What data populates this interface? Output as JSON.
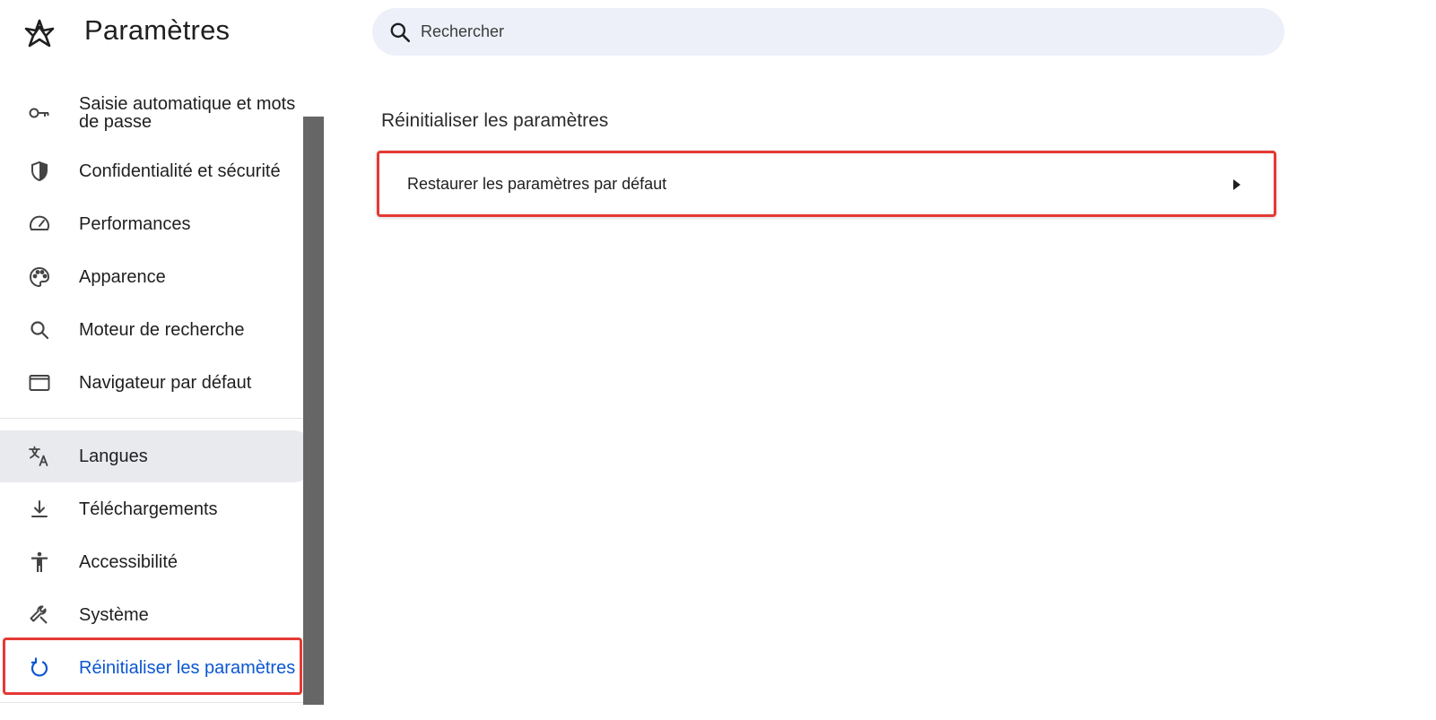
{
  "app": {
    "title": "Paramètres"
  },
  "search": {
    "placeholder": "Rechercher"
  },
  "sidebar": {
    "items": [
      {
        "label": "Saisie automatique et mots de passe",
        "icon": "key-icon"
      },
      {
        "label": "Confidentialité et sécurité",
        "icon": "shield-icon"
      },
      {
        "label": "Performances",
        "icon": "speedometer-icon"
      },
      {
        "label": "Apparence",
        "icon": "palette-icon"
      },
      {
        "label": "Moteur de recherche",
        "icon": "search-icon"
      },
      {
        "label": "Navigateur par défaut",
        "icon": "browser-window-icon"
      },
      {
        "label": "Langues",
        "icon": "translate-icon",
        "state": "hovered"
      },
      {
        "label": "Téléchargements",
        "icon": "download-icon"
      },
      {
        "label": "Accessibilité",
        "icon": "accessibility-icon"
      },
      {
        "label": "Système",
        "icon": "wrench-icon"
      },
      {
        "label": "Réinitialiser les paramètres",
        "icon": "reset-icon",
        "state": "selected"
      }
    ]
  },
  "main": {
    "section_title": "Réinitialiser les paramètres",
    "card": {
      "label": "Restaurer les paramètres par défaut",
      "icon": "arrow-right-icon"
    }
  },
  "colors": {
    "accent": "#0b57d0",
    "highlight": "#e53935",
    "search_bg": "#edf0f9",
    "hover_bg": "#e9eaee",
    "scrollbar": "#666666"
  }
}
